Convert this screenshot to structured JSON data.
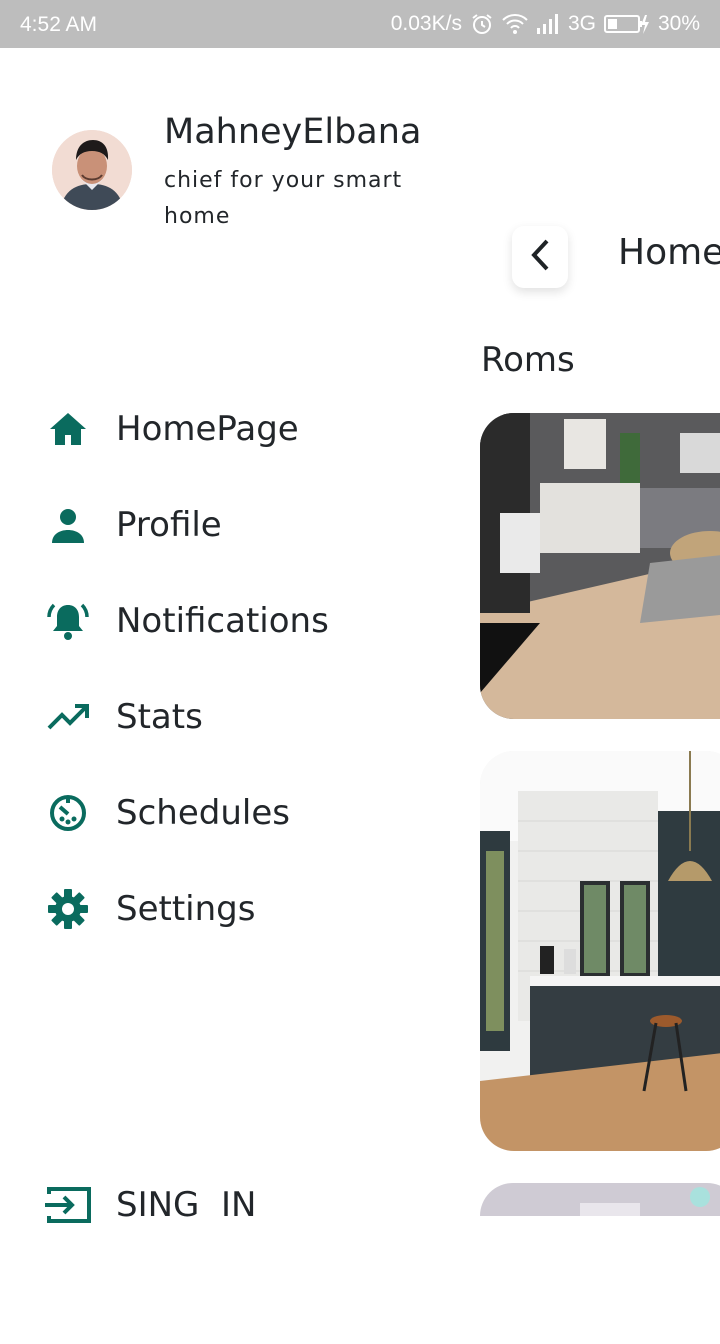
{
  "status_bar": {
    "time": "4:52 AM",
    "speed": "0.03K/s",
    "network": "3G",
    "battery": "30%"
  },
  "profile": {
    "name": "MahneyElbana",
    "subtitle": "chief for your smart home"
  },
  "nav": {
    "items": [
      {
        "label": "HomePage",
        "icon": "home-icon"
      },
      {
        "label": "Profile",
        "icon": "person-icon"
      },
      {
        "label": "Notifications",
        "icon": "bell-icon"
      },
      {
        "label": "Stats",
        "icon": "trending-up-icon"
      },
      {
        "label": "Schedules",
        "icon": "timer-icon"
      },
      {
        "label": "Settings",
        "icon": "gear-icon"
      }
    ],
    "sign_in": {
      "label": "SING  IN",
      "icon": "login-icon"
    }
  },
  "main": {
    "title": "Home",
    "section": "Roms"
  },
  "colors": {
    "accent": "#0a6b5e",
    "status_bar": "#bdbdbd",
    "text": "#22262a"
  }
}
